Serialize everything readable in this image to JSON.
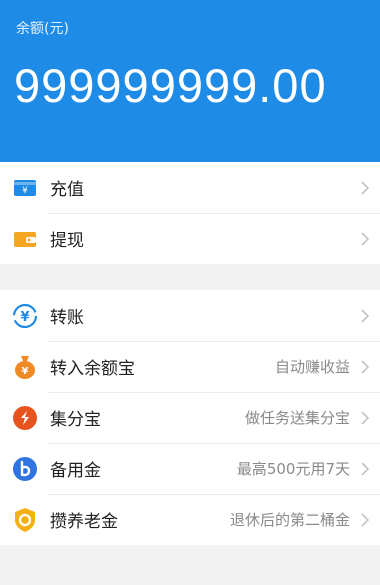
{
  "balance": {
    "label": "余额(元)",
    "amount": "999999999.00"
  },
  "colors": {
    "brand": "#1e8be7"
  },
  "menu1": [
    {
      "title": "充值",
      "subtitle": "",
      "icon": "recharge-card-icon"
    },
    {
      "title": "提现",
      "subtitle": "",
      "icon": "wallet-icon"
    }
  ],
  "menu2": [
    {
      "title": "转账",
      "subtitle": "",
      "icon": "transfer-yuan-icon"
    },
    {
      "title": "转入余额宝",
      "subtitle": "自动赚收益",
      "icon": "money-bag-icon"
    },
    {
      "title": "集分宝",
      "subtitle": "做任务送集分宝",
      "icon": "points-icon"
    },
    {
      "title": "备用金",
      "subtitle": "最高500元用7天",
      "icon": "reserve-fund-icon"
    },
    {
      "title": "攒养老金",
      "subtitle": "退休后的第二桶金",
      "icon": "pension-icon"
    }
  ]
}
